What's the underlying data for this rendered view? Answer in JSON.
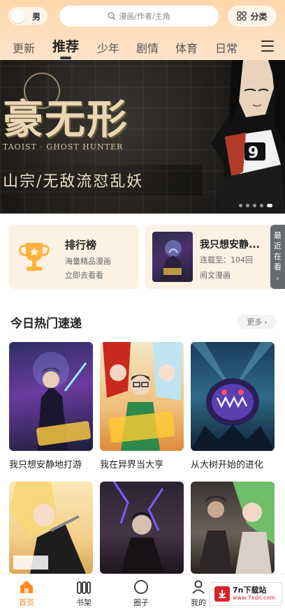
{
  "header": {
    "gender_label": "男",
    "search_placeholder": "漫画/作者/主角",
    "category_label": "分类"
  },
  "tabs": [
    "更新",
    "推荐",
    "少年",
    "剧情",
    "体育",
    "日常"
  ],
  "active_tab": "推荐",
  "banner": {
    "title": "豪无形",
    "subtitle": "TAOIST · GHOST HUNTER",
    "tagline": "山宗/无敌流怼乱妖",
    "slide_count": 5,
    "active_slide": 5
  },
  "ranking_card": {
    "title": "排行榜",
    "subtitle": "海量精品漫画",
    "link": "立即去看看"
  },
  "continue_card": {
    "title": "我只想安静...",
    "progress": "连载至：104回",
    "link": "阅文漫画"
  },
  "recent_tab": [
    "最",
    "近",
    "在",
    "看"
  ],
  "section": {
    "title": "今日热门速递",
    "more": "更多"
  },
  "comics": [
    {
      "title": "我只想安静地打游"
    },
    {
      "title": "我在异界当大亨"
    },
    {
      "title": "从大树开始的进化"
    },
    {
      "title": ""
    },
    {
      "title": ""
    },
    {
      "title": ""
    }
  ],
  "bottom_nav": [
    {
      "label": "首页",
      "icon": "home-icon"
    },
    {
      "label": "书架",
      "icon": "bookshelf-icon"
    },
    {
      "label": "圈子",
      "icon": "circle-icon"
    },
    {
      "label": "我的",
      "icon": "profile-icon"
    }
  ],
  "watermark": {
    "name": "7n下载站",
    "url": "www.7xdn.com"
  },
  "colors": {
    "accent": "#ff8a1f",
    "header_bg": "#ffd7ad",
    "card_bg": "#fdf1e3"
  }
}
